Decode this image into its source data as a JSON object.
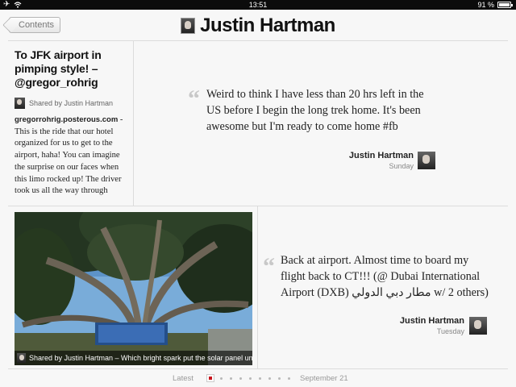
{
  "status_bar": {
    "time": "13:51",
    "battery": "91 %",
    "airplane_icon": "airplane-icon",
    "wifi_icon": "wifi-icon",
    "battery_level": 0.91
  },
  "header": {
    "back_label": "Contents",
    "title": "Justin Hartman"
  },
  "article": {
    "title": "To JFK airport in pimping style! – @gregor_rohrig",
    "shared_by": "Shared by Justin Hartman",
    "source": "gregorrohrig.posterous.com",
    "body": " - This is the ride that our hotel organized for us to get to the airport, haha! You can imagine the surprise on our faces when this limo rocked up! The driver took us all the way through downtown Manhattan, nice way to"
  },
  "quote1": {
    "text": "Weird to think I have less than 20 hrs left in the US before I begin the long trek home. It's been awesome but I'm ready to come home #fb",
    "author": "Justin Hartman",
    "when": "Sunday"
  },
  "photo": {
    "caption": "Shared by Justin Hartman – Which bright spark put the solar panel un..."
  },
  "quote2": {
    "text": "Back at airport. Almost time to board my flight back to CT!!! (@ Dubai International Airport (DXB) مطار دبي الدولي w/ 2 others)",
    "author": "Justin Hartman",
    "when": "Tuesday"
  },
  "pager": {
    "latest": "Latest",
    "date": "September 21",
    "current_page": 1,
    "page_count": 10
  },
  "colors": {
    "accent": "#c8161d",
    "background": "#f7f7f7",
    "divider": "#dcdcdc"
  }
}
